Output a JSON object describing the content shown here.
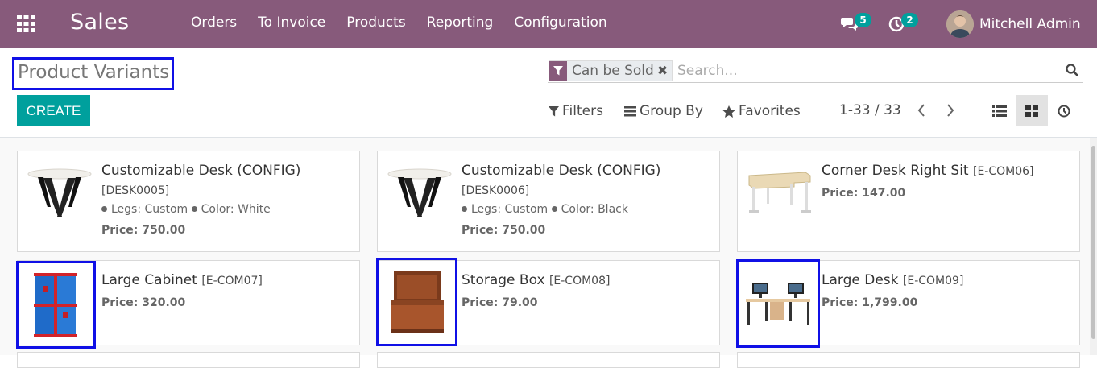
{
  "navbar": {
    "apps_icon": "grid-apps-icon",
    "brand": "Sales",
    "menu": [
      {
        "label": "Orders"
      },
      {
        "label": "To Invoice"
      },
      {
        "label": "Products"
      },
      {
        "label": "Reporting"
      },
      {
        "label": "Configuration"
      }
    ],
    "systray": {
      "messages_count": "5",
      "activities_count": "2",
      "user_name": "Mitchell Admin"
    },
    "colors": {
      "navbar_bg": "#875a7b",
      "badge_bg": "#00a09d"
    }
  },
  "control_panel": {
    "title": "Product Variants",
    "create_label": "CREATE",
    "search": {
      "facet_value": "Can be Sold",
      "placeholder": "Search..."
    },
    "filters_label": "Filters",
    "group_by_label": "Group By",
    "favorites_label": "Favorites",
    "pager": {
      "value": "1-33 / 33"
    },
    "views": [
      "list-view-icon",
      "kanban-view-icon",
      "activity-view-icon"
    ],
    "active_view": "kanban",
    "colors": {
      "primary": "#00a09d"
    }
  },
  "kanban": {
    "cards": [
      {
        "name": "Customizable Desk (CONFIG)",
        "ref": "[DESK0005]",
        "attr1": "Legs: Custom",
        "attr2": "Color: White",
        "price": "Price: 750.00",
        "image": "round-white-desk-image"
      },
      {
        "name": "Customizable Desk (CONFIG)",
        "ref": "[DESK0006]",
        "attr1": "Legs: Custom",
        "attr2": "Color: Black",
        "price": "Price: 750.00",
        "image": "round-white-desk-image"
      },
      {
        "name": "Corner Desk Right Sit",
        "code": "[E-COM06]",
        "price": "Price: 147.00",
        "image": "corner-desk-image"
      },
      {
        "name": "Large Cabinet",
        "code": "[E-COM07]",
        "price": "Price: 320.00",
        "image": "red-blue-cabinet-image"
      },
      {
        "name": "Storage Box",
        "code": "[E-COM08]",
        "price": "Price: 79.00",
        "image": "wooden-box-image"
      },
      {
        "name": "Large Desk",
        "code": "[E-COM09]",
        "price": "Price: 1,799.00",
        "image": "large-desk-image"
      }
    ]
  }
}
